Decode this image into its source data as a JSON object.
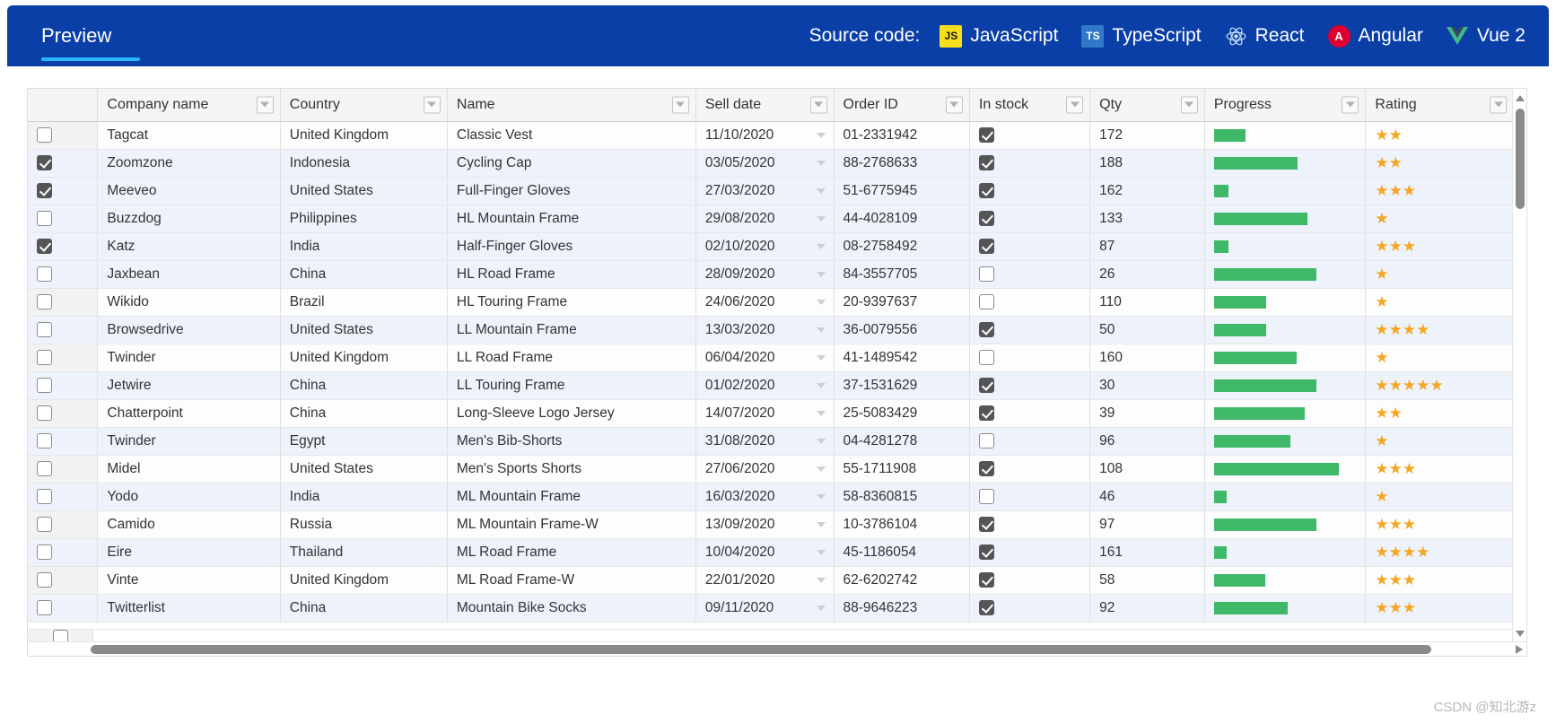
{
  "header": {
    "preview_tab": "Preview",
    "source_label": "Source code:",
    "links": [
      {
        "label": "JavaScript",
        "icon": "javascript-icon",
        "badge": "JS",
        "color": "#f7df1e"
      },
      {
        "label": "TypeScript",
        "icon": "typescript-icon",
        "badge": "TS",
        "color": "#3178c6"
      },
      {
        "label": "React",
        "icon": "react-icon",
        "badge": "",
        "color": "#61dafb"
      },
      {
        "label": "Angular",
        "icon": "angular-icon",
        "badge": "A",
        "color": "#dd0031"
      },
      {
        "label": "Vue 2",
        "icon": "vue-icon",
        "badge": "",
        "color": "#41b883"
      }
    ],
    "bar_color": "#0b3fa8",
    "accent_color": "#29b6f6"
  },
  "grid": {
    "columns": [
      {
        "key": "select",
        "label": "",
        "filter": false
      },
      {
        "key": "company",
        "label": "Company name",
        "filter": true
      },
      {
        "key": "country",
        "label": "Country",
        "filter": true
      },
      {
        "key": "name",
        "label": "Name",
        "filter": true
      },
      {
        "key": "date",
        "label": "Sell date",
        "filter": true
      },
      {
        "key": "order",
        "label": "Order ID",
        "filter": true
      },
      {
        "key": "stock",
        "label": "In stock",
        "filter": true
      },
      {
        "key": "qty",
        "label": "Qty",
        "filter": true
      },
      {
        "key": "progress",
        "label": "Progress",
        "filter": true
      },
      {
        "key": "rating",
        "label": "Rating",
        "filter": true
      }
    ],
    "progress_color": "#3fb968",
    "star_color": "#f5a623",
    "star_glyph": "★",
    "rows": [
      {
        "selected": false,
        "company": "Tagcat",
        "country": "United Kingdom",
        "name": "Classic Vest",
        "date": "11/10/2020",
        "order": "01-2331942",
        "stock": true,
        "qty": "172",
        "progress": 22,
        "rating": 2
      },
      {
        "selected": true,
        "company": "Zoomzone",
        "country": "Indonesia",
        "name": "Cycling Cap",
        "date": "03/05/2020",
        "order": "88-2768633",
        "stock": true,
        "qty": "188",
        "progress": 59,
        "rating": 2
      },
      {
        "selected": true,
        "company": "Meeveo",
        "country": "United States",
        "name": "Full-Finger Gloves",
        "date": "27/03/2020",
        "order": "51-6775945",
        "stock": true,
        "qty": "162",
        "progress": 10,
        "rating": 3
      },
      {
        "selected": false,
        "company": "Buzzdog",
        "country": "Philippines",
        "name": "HL Mountain Frame",
        "date": "29/08/2020",
        "order": "44-4028109",
        "stock": true,
        "qty": "133",
        "progress": 66,
        "rating": 1
      },
      {
        "selected": true,
        "company": "Katz",
        "country": "India",
        "name": "Half-Finger Gloves",
        "date": "02/10/2020",
        "order": "08-2758492",
        "stock": true,
        "qty": "87",
        "progress": 10,
        "rating": 3
      },
      {
        "selected": false,
        "company": "Jaxbean",
        "country": "China",
        "name": "HL Road Frame",
        "date": "28/09/2020",
        "order": "84-3557705",
        "stock": false,
        "qty": "26",
        "progress": 72,
        "rating": 1
      },
      {
        "selected": false,
        "company": "Wikido",
        "country": "Brazil",
        "name": "HL Touring Frame",
        "date": "24/06/2020",
        "order": "20-9397637",
        "stock": false,
        "qty": "110",
        "progress": 37,
        "rating": 1
      },
      {
        "selected": false,
        "company": "Browsedrive",
        "country": "United States",
        "name": "LL Mountain Frame",
        "date": "13/03/2020",
        "order": "36-0079556",
        "stock": true,
        "qty": "50",
        "progress": 37,
        "rating": 4
      },
      {
        "selected": false,
        "company": "Twinder",
        "country": "United Kingdom",
        "name": "LL Road Frame",
        "date": "06/04/2020",
        "order": "41-1489542",
        "stock": false,
        "qty": "160",
        "progress": 58,
        "rating": 1
      },
      {
        "selected": false,
        "company": "Jetwire",
        "country": "China",
        "name": "LL Touring Frame",
        "date": "01/02/2020",
        "order": "37-1531629",
        "stock": true,
        "qty": "30",
        "progress": 72,
        "rating": 5
      },
      {
        "selected": false,
        "company": "Chatterpoint",
        "country": "China",
        "name": "Long-Sleeve Logo Jersey",
        "date": "14/07/2020",
        "order": "25-5083429",
        "stock": true,
        "qty": "39",
        "progress": 64,
        "rating": 2
      },
      {
        "selected": false,
        "company": "Twinder",
        "country": "Egypt",
        "name": "Men's Bib-Shorts",
        "date": "31/08/2020",
        "order": "04-4281278",
        "stock": false,
        "qty": "96",
        "progress": 54,
        "rating": 1
      },
      {
        "selected": false,
        "company": "Midel",
        "country": "United States",
        "name": "Men's Sports Shorts",
        "date": "27/06/2020",
        "order": "55-1711908",
        "stock": true,
        "qty": "108",
        "progress": 88,
        "rating": 3
      },
      {
        "selected": false,
        "company": "Yodo",
        "country": "India",
        "name": "ML Mountain Frame",
        "date": "16/03/2020",
        "order": "58-8360815",
        "stock": false,
        "qty": "46",
        "progress": 9,
        "rating": 1
      },
      {
        "selected": false,
        "company": "Camido",
        "country": "Russia",
        "name": "ML Mountain Frame-W",
        "date": "13/09/2020",
        "order": "10-3786104",
        "stock": true,
        "qty": "97",
        "progress": 72,
        "rating": 3
      },
      {
        "selected": false,
        "company": "Eire",
        "country": "Thailand",
        "name": "ML Road Frame",
        "date": "10/04/2020",
        "order": "45-1186054",
        "stock": true,
        "qty": "161",
        "progress": 9,
        "rating": 4
      },
      {
        "selected": false,
        "company": "Vinte",
        "country": "United Kingdom",
        "name": "ML Road Frame-W",
        "date": "22/01/2020",
        "order": "62-6202742",
        "stock": true,
        "qty": "58",
        "progress": 36,
        "rating": 3
      },
      {
        "selected": false,
        "company": "Twitterlist",
        "country": "China",
        "name": "Mountain Bike Socks",
        "date": "09/11/2020",
        "order": "88-9646223",
        "stock": true,
        "qty": "92",
        "progress": 52,
        "rating": 3
      }
    ]
  },
  "watermark": "CSDN @知北游z"
}
